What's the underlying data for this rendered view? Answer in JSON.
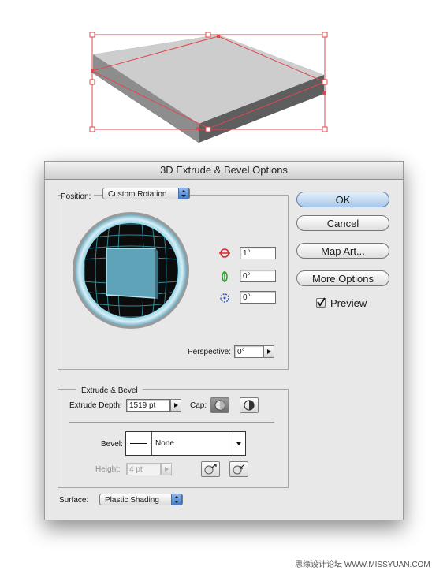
{
  "dialog": {
    "title": "3D Extrude & Bevel Options",
    "position": {
      "label": "Position:",
      "value": "Custom Rotation",
      "rotation_x": "1°",
      "rotation_y": "0°",
      "rotation_z": "0°",
      "perspective_label": "Perspective:",
      "perspective_value": "0°"
    },
    "extrude_bevel": {
      "group_title": "Extrude & Bevel",
      "depth_label": "Extrude Depth:",
      "depth_value": "1519 pt",
      "cap_label": "Cap:",
      "bevel_label": "Bevel:",
      "bevel_value": "None",
      "height_label": "Height:",
      "height_value": "4 pt"
    },
    "surface": {
      "label": "Surface:",
      "value": "Plastic Shading"
    },
    "buttons": {
      "ok": "OK",
      "cancel": "Cancel",
      "map_art": "Map Art...",
      "more_options": "More Options"
    },
    "preview": {
      "label": "Preview",
      "checked": true
    }
  },
  "watermark": "思缘设计论坛 WWW.MISSYUAN.COM",
  "colors": {
    "selection": "#e0474c",
    "cube_face": "#5fa3b8",
    "default_button": "#a9c8e9"
  }
}
